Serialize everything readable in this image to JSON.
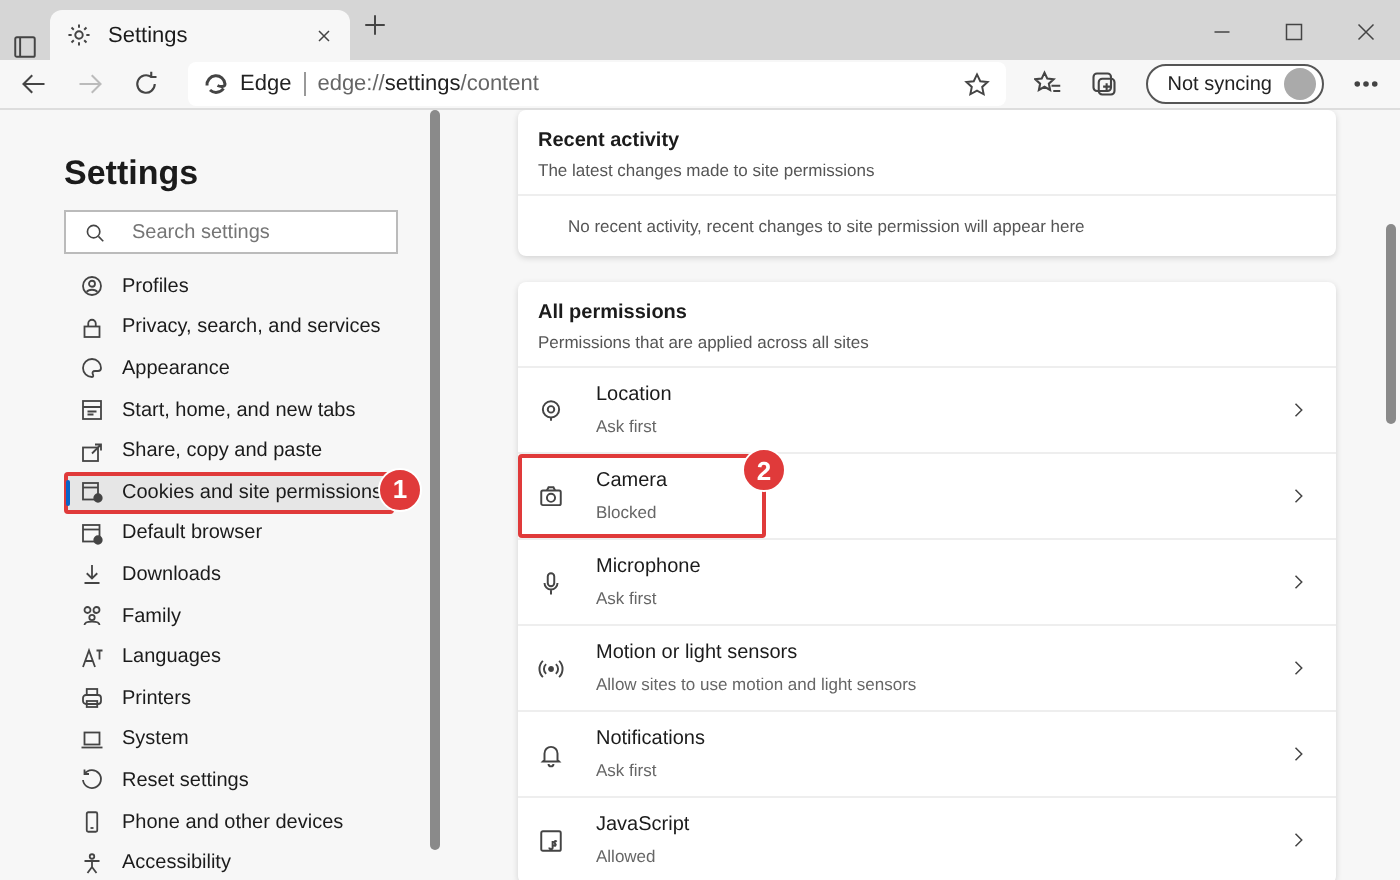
{
  "tab": {
    "title": "Settings"
  },
  "address_bar": {
    "site_label": "Edge",
    "url_prefix": "edge://",
    "url_bold": "settings",
    "url_suffix": "/content"
  },
  "profile_button": {
    "label": "Not syncing"
  },
  "sidebar": {
    "title": "Settings",
    "search": {
      "placeholder": "Search settings"
    },
    "items": [
      {
        "label": "Profiles",
        "selected": false
      },
      {
        "label": "Privacy, search, and services",
        "selected": false
      },
      {
        "label": "Appearance",
        "selected": false
      },
      {
        "label": "Start, home, and new tabs",
        "selected": false
      },
      {
        "label": "Share, copy and paste",
        "selected": false
      },
      {
        "label": "Cookies and site permissions",
        "selected": true,
        "callout": "1"
      },
      {
        "label": "Default browser",
        "selected": false
      },
      {
        "label": "Downloads",
        "selected": false
      },
      {
        "label": "Family",
        "selected": false
      },
      {
        "label": "Languages",
        "selected": false
      },
      {
        "label": "Printers",
        "selected": false
      },
      {
        "label": "System",
        "selected": false
      },
      {
        "label": "Reset settings",
        "selected": false
      },
      {
        "label": "Phone and other devices",
        "selected": false
      },
      {
        "label": "Accessibility",
        "selected": false
      }
    ]
  },
  "recent_activity": {
    "title": "Recent activity",
    "subtitle": "The latest changes made to site permissions",
    "empty_text": "No recent activity, recent changes to site permission will appear here"
  },
  "all_permissions": {
    "title": "All permissions",
    "subtitle": "Permissions that are applied across all sites",
    "items": [
      {
        "label": "Location",
        "status": "Ask first"
      },
      {
        "label": "Camera",
        "status": "Blocked",
        "callout": "2"
      },
      {
        "label": "Microphone",
        "status": "Ask first"
      },
      {
        "label": "Motion or light sensors",
        "status": "Allow sites to use motion and light sensors"
      },
      {
        "label": "Notifications",
        "status": "Ask first"
      },
      {
        "label": "JavaScript",
        "status": "Allowed"
      }
    ]
  }
}
